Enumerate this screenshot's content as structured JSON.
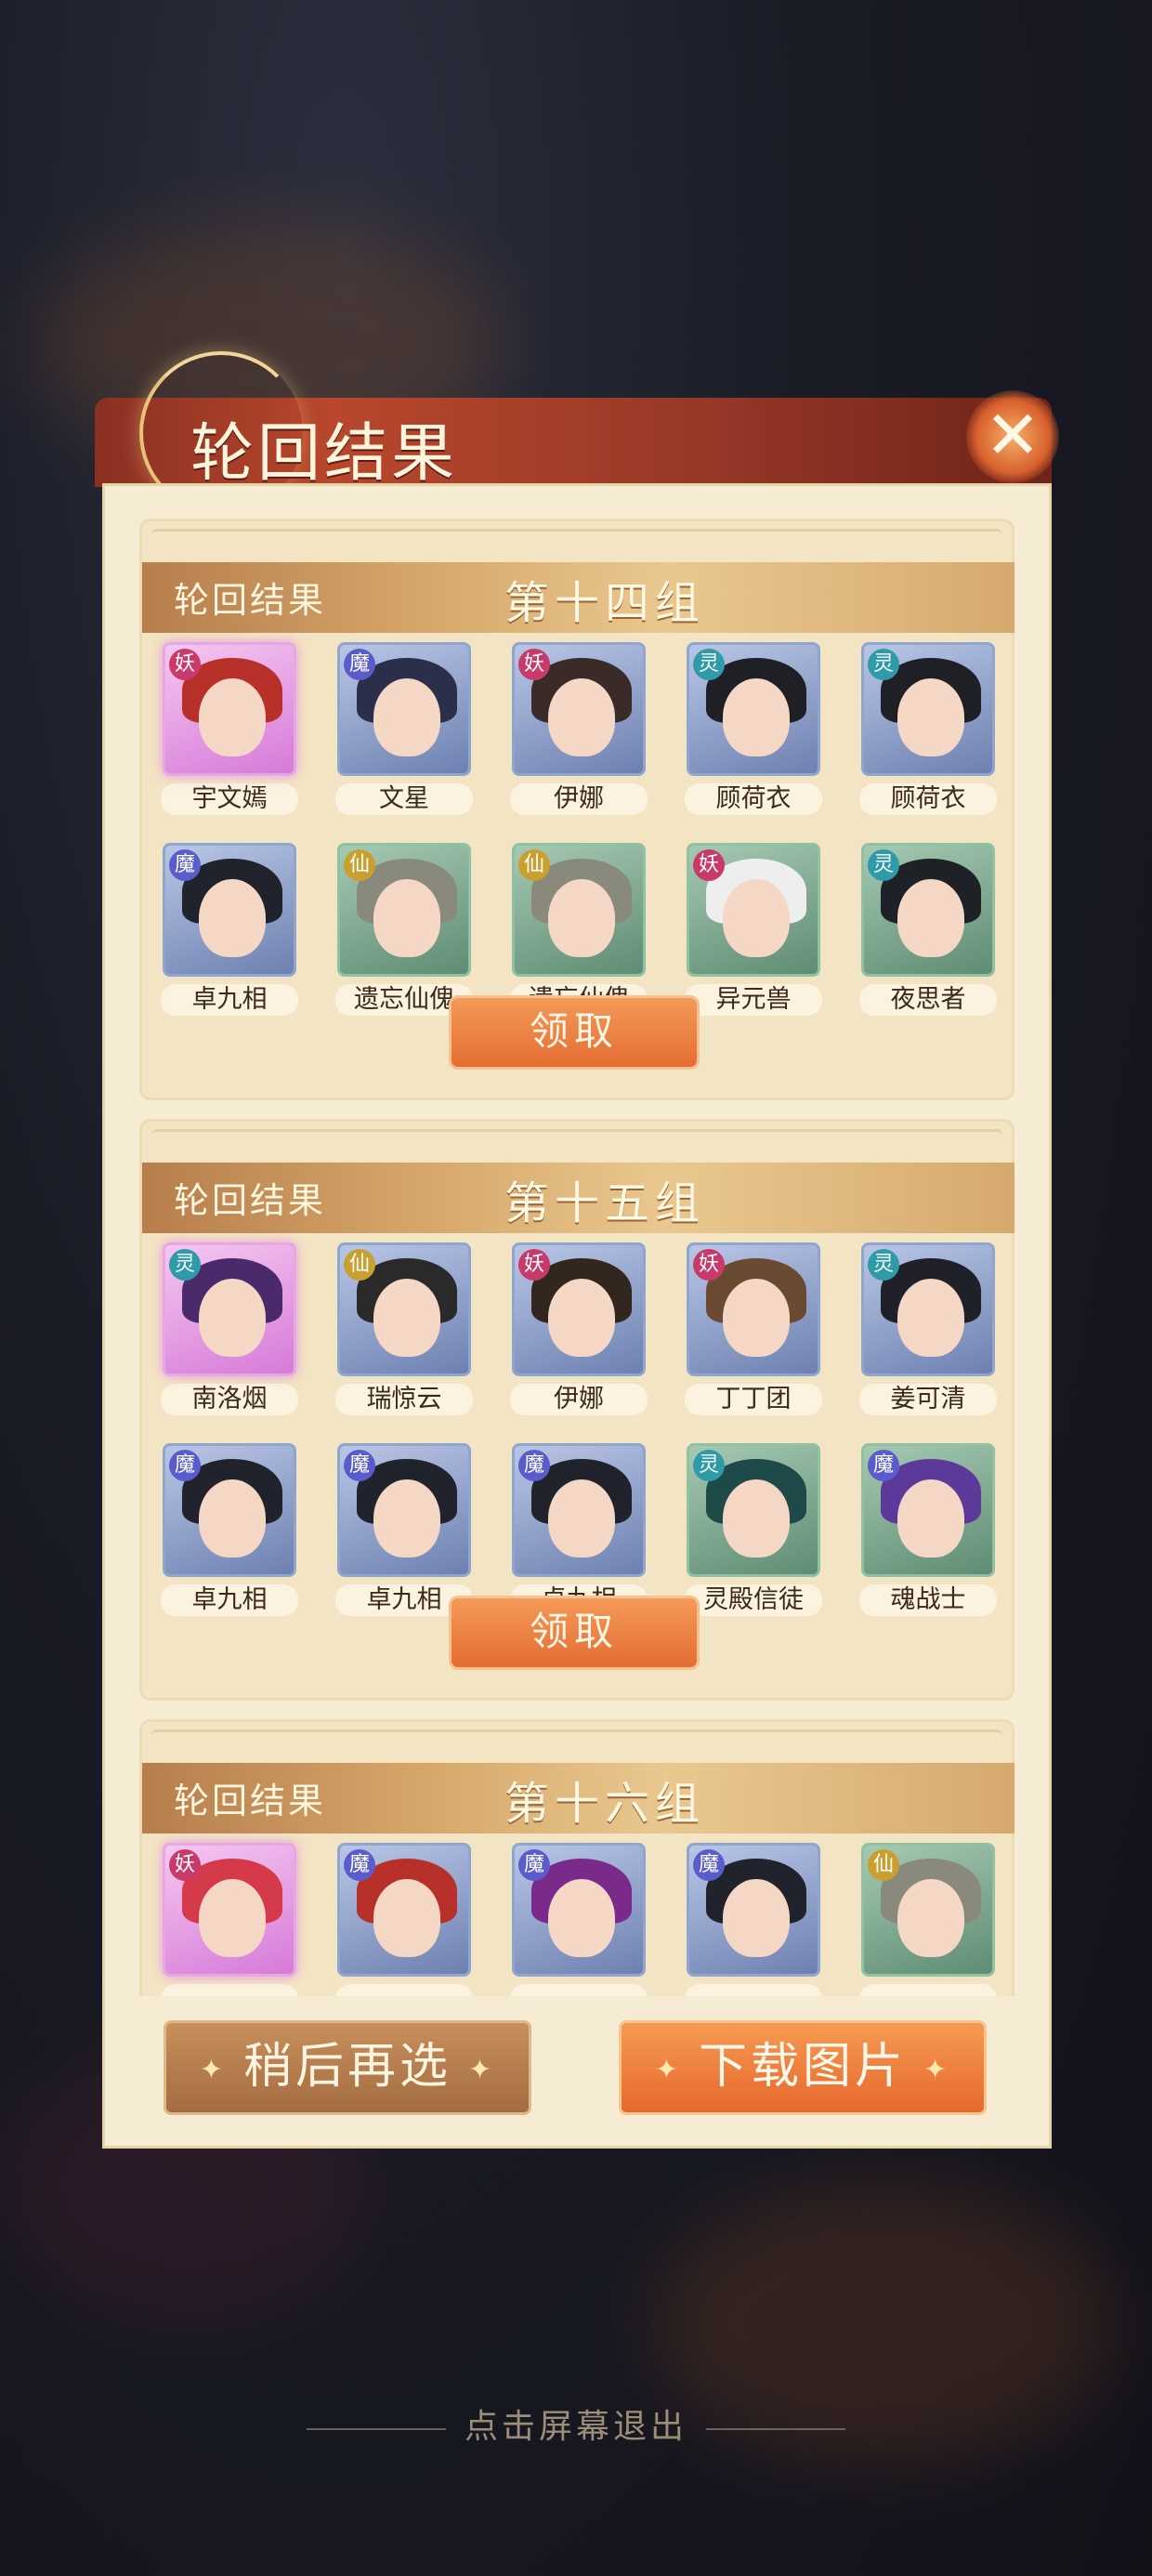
{
  "window": {
    "title": "轮回结果",
    "close_icon": "close-icon"
  },
  "groups": [
    {
      "label": "轮回结果",
      "name": "第十四组",
      "claim_label": "领取",
      "heroes": [
        {
          "name": "宇文嫣",
          "badge": "妖",
          "frame": "pink"
        },
        {
          "name": "文星",
          "badge": "魔",
          "frame": "blue"
        },
        {
          "name": "伊娜",
          "badge": "妖",
          "frame": "blue"
        },
        {
          "name": "顾荷衣",
          "badge": "灵",
          "frame": "blue"
        },
        {
          "name": "顾荷衣",
          "badge": "灵",
          "frame": "blue"
        },
        {
          "name": "卓九相",
          "badge": "魔",
          "frame": "blue"
        },
        {
          "name": "遗忘仙傀",
          "badge": "仙",
          "frame": "green"
        },
        {
          "name": "遗忘仙傀",
          "badge": "仙",
          "frame": "green"
        },
        {
          "name": "异元兽",
          "badge": "妖",
          "frame": "green"
        },
        {
          "name": "夜思者",
          "badge": "灵",
          "frame": "green"
        }
      ]
    },
    {
      "label": "轮回结果",
      "name": "第十五组",
      "claim_label": "领取",
      "heroes": [
        {
          "name": "南洛烟",
          "badge": "灵",
          "frame": "pink"
        },
        {
          "name": "瑞惊云",
          "badge": "仙",
          "frame": "blue"
        },
        {
          "name": "伊娜",
          "badge": "妖",
          "frame": "blue"
        },
        {
          "name": "丁丁团",
          "badge": "妖",
          "frame": "blue"
        },
        {
          "name": "姜可清",
          "badge": "灵",
          "frame": "blue"
        },
        {
          "name": "卓九相",
          "badge": "魔",
          "frame": "blue"
        },
        {
          "name": "卓九相",
          "badge": "魔",
          "frame": "blue"
        },
        {
          "name": "卓九相",
          "badge": "魔",
          "frame": "blue"
        },
        {
          "name": "灵殿信徒",
          "badge": "灵",
          "frame": "green"
        },
        {
          "name": "魂战士",
          "badge": "魔",
          "frame": "green"
        }
      ]
    },
    {
      "label": "轮回结果",
      "name": "第十六组",
      "claim_label": "",
      "heroes": [
        {
          "name": "",
          "badge": "妖",
          "frame": "pink"
        },
        {
          "name": "",
          "badge": "魔",
          "frame": "blue"
        },
        {
          "name": "",
          "badge": "魔",
          "frame": "blue"
        },
        {
          "name": "",
          "badge": "魔",
          "frame": "blue"
        },
        {
          "name": "",
          "badge": "仙",
          "frame": "green"
        }
      ]
    }
  ],
  "actions": {
    "later_label": "稍后再选",
    "download_label": "下载图片"
  },
  "footer": {
    "exit_hint": "点击屏幕退出"
  },
  "colors": {
    "accent": "#e46d33",
    "panel": "#f6ecd4",
    "title_bar": "#b8472c"
  }
}
